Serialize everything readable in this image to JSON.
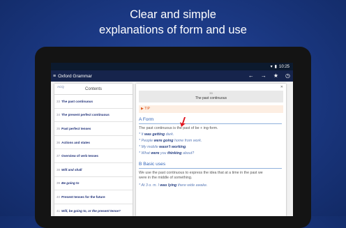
{
  "headline": {
    "line1": "Clear and simple",
    "line2": "explanations of form and use"
  },
  "status_bar": {
    "time": "10:25"
  },
  "app_bar": {
    "title": "Oxford Grammar",
    "menu_icon": "menu-icon",
    "actions": [
      {
        "icon": "arrow-back-icon",
        "glyph": "←"
      },
      {
        "icon": "arrow-forward-icon",
        "glyph": "→"
      },
      {
        "icon": "star-icon",
        "glyph": "★"
      },
      {
        "icon": "history-icon",
        "glyph": "◷"
      }
    ]
  },
  "toc": {
    "back_label": "ACQ",
    "title": "Contents",
    "items": [
      {
        "num": "33",
        "label": "The past continuous"
      },
      {
        "num": "34",
        "label": "The present perfect continuous"
      },
      {
        "num": "35",
        "label": "Past perfect tenses"
      },
      {
        "num": "36",
        "label": "Actions and states"
      },
      {
        "num": "37",
        "label": "Overview of verb tenses"
      },
      {
        "num": "38",
        "label": "Will and shall"
      },
      {
        "num": "39",
        "label": "Be going to"
      },
      {
        "num": "40",
        "label": "Present tenses for the future"
      },
      {
        "num": "41",
        "label": "Will, be going to, or the present tense?"
      }
    ]
  },
  "article": {
    "number": "33",
    "title": "The past continuous",
    "tip": "▶ TIP",
    "section_a": "A Form",
    "form_text": "The past continuous is the past of be + ing-form.",
    "examples_a": [
      {
        "pre": "* It ",
        "bold": "was getting",
        "post": " dark."
      },
      {
        "pre": "* People ",
        "bold": "were going",
        "post": " home from work."
      },
      {
        "pre": "* My mobile ",
        "bold": "wasn't working",
        "post": "."
      },
      {
        "pre": "* What ",
        "bold": "were",
        "mid": " you ",
        "bold2": "thinking",
        "post": " about?"
      }
    ],
    "section_b": "B Basic uses",
    "use_text_1": "We use the past continuous to express the idea that at a time in the past we",
    "use_text_2": "were in the middle of something.",
    "examples_b": [
      {
        "pre": "* At 3 o. m. I ",
        "bold": "was lying",
        "post": " there wide awake."
      }
    ]
  }
}
